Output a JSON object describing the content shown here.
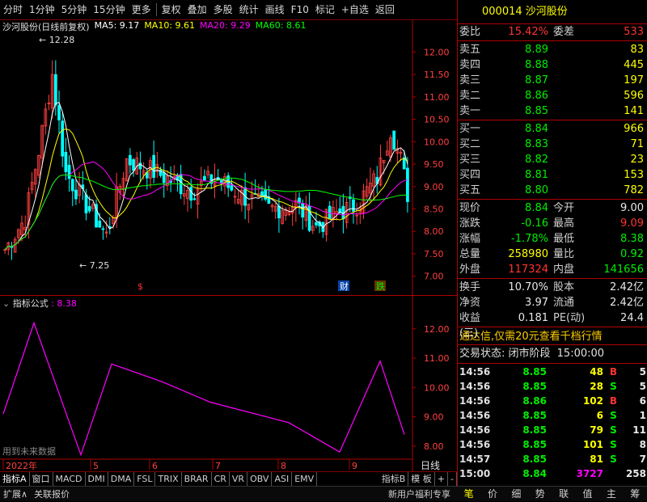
{
  "toolbar": {
    "items": [
      "分时",
      "1分钟",
      "5分钟",
      "15分钟",
      "更多",
      "复权",
      "叠加",
      "多股",
      "统计",
      "画线",
      "F10",
      "标记",
      "+自选",
      "返回"
    ]
  },
  "chart": {
    "stock_label": "沙河股份(日线前复权)",
    "ma5_label": "MA5: 9.17",
    "ma10_label": "MA10: 9.61",
    "ma20_label": "MA20: 9.29",
    "ma60_label": "MA60: 8.61",
    "colors": {
      "ma5": "#ffffff",
      "ma10": "#ffff00",
      "ma20": "#ff00ff",
      "ma60": "#00ff00",
      "up": "#ff4040",
      "down": "#00ffff"
    },
    "high_label": "12.28",
    "low_label": "7.25",
    "price_ticks": [
      "12.00",
      "11.50",
      "11.00",
      "10.50",
      "10.00",
      "9.50",
      "9.00",
      "8.50",
      "8.00",
      "7.50",
      "7.00"
    ],
    "event_marks": [
      "$",
      "财",
      "跌"
    ],
    "indicator_label": "指标公式",
    "indicator_value": ": 8.38",
    "indicator_ticks": [
      "12.00",
      "11.00",
      "10.00",
      "9.00",
      "8.00"
    ],
    "indicator_note": "用到未来数据",
    "x_labels": [
      "2022年",
      "5",
      "6",
      "7",
      "8",
      "9"
    ],
    "period_label": "日线"
  },
  "chart_data": {
    "type": "line",
    "x": [
      0,
      1,
      2,
      3,
      4,
      5,
      6,
      7,
      8,
      9
    ],
    "series": [
      {
        "values": [
          9.1,
          12.2,
          7.7,
          10.8,
          10.2,
          9.5,
          8.8,
          7.8,
          10.9,
          8.4
        ]
      }
    ],
    "ylim": [
      7.5,
      12.6
    ]
  },
  "bottom_tabs": [
    "指标A",
    "窗口",
    "MACD",
    "DMI",
    "DMA",
    "FSL",
    "TRIX",
    "BRAR",
    "CR",
    "VR",
    "OBV",
    "ASI",
    "EMV",
    "指标B",
    "模 板",
    "+",
    "-"
  ],
  "bottom_tabs2": [
    "扩展∧",
    "关联报价",
    "新用户福利专享"
  ],
  "right_tabs": [
    "笔",
    "价",
    "细",
    "势",
    "联",
    "值",
    "主",
    "筹"
  ],
  "quote": {
    "title": "000014 沙河股份",
    "weibi_label": "委比",
    "weibi": "15.42%",
    "weicha_label": "委差",
    "weicha": "533",
    "sell": [
      {
        "label": "卖五",
        "price": "8.89",
        "vol": "83"
      },
      {
        "label": "卖四",
        "price": "8.88",
        "vol": "445"
      },
      {
        "label": "卖三",
        "price": "8.87",
        "vol": "197"
      },
      {
        "label": "卖二",
        "price": "8.86",
        "vol": "596"
      },
      {
        "label": "卖一",
        "price": "8.85",
        "vol": "141"
      }
    ],
    "buy": [
      {
        "label": "买一",
        "price": "8.84",
        "vol": "966"
      },
      {
        "label": "买二",
        "price": "8.83",
        "vol": "71"
      },
      {
        "label": "买三",
        "price": "8.82",
        "vol": "23"
      },
      {
        "label": "买四",
        "price": "8.81",
        "vol": "153"
      },
      {
        "label": "买五",
        "price": "8.80",
        "vol": "782"
      }
    ],
    "stats1": [
      {
        "l1": "现价",
        "v1": "8.84",
        "c1": "green",
        "l2": "今开",
        "v2": "9.00",
        "c2": "white"
      },
      {
        "l1": "涨跌",
        "v1": "-0.16",
        "c1": "green",
        "l2": "最高",
        "v2": "9.09",
        "c2": "red"
      },
      {
        "l1": "涨幅",
        "v1": "-1.78%",
        "c1": "green",
        "l2": "最低",
        "v2": "8.38",
        "c2": "green"
      },
      {
        "l1": "总量",
        "v1": "258980",
        "c1": "yellow",
        "l2": "量比",
        "v2": "0.92",
        "c2": "green"
      },
      {
        "l1": "外盘",
        "v1": "117324",
        "c1": "red",
        "l2": "内盘",
        "v2": "141656",
        "c2": "green"
      }
    ],
    "stats2": [
      {
        "l1": "换手",
        "v1": "10.70%",
        "c1": "white",
        "l2": "股本",
        "v2": "2.42亿",
        "c2": "white"
      },
      {
        "l1": "净资",
        "v1": "3.97",
        "c1": "white",
        "l2": "流通",
        "v2": "2.42亿",
        "c2": "white"
      },
      {
        "l1": "收益(三)",
        "v1": "0.181",
        "c1": "white",
        "l2": "PE(动)",
        "v2": "24.4",
        "c2": "white"
      }
    ],
    "ad": "通达信,仅需20元查看千档行情",
    "state_label": "交易状态: 闭市阶段",
    "state_time": "15:00:00",
    "ticks": [
      {
        "t": "14:56",
        "p": "8.85",
        "v": "48",
        "bs": "B",
        "n": "5"
      },
      {
        "t": "14:56",
        "p": "8.85",
        "v": "28",
        "bs": "S",
        "n": "5"
      },
      {
        "t": "14:56",
        "p": "8.86",
        "v": "102",
        "bs": "B",
        "n": "6"
      },
      {
        "t": "14:56",
        "p": "8.85",
        "v": "6",
        "bs": "S",
        "n": "1"
      },
      {
        "t": "14:56",
        "p": "8.85",
        "v": "79",
        "bs": "S",
        "n": "11"
      },
      {
        "t": "14:56",
        "p": "8.85",
        "v": "101",
        "bs": "S",
        "n": "8"
      },
      {
        "t": "14:57",
        "p": "8.85",
        "v": "81",
        "bs": "S",
        "n": "7"
      },
      {
        "t": "15:00",
        "p": "8.84",
        "v": "3727",
        "bs": "",
        "n": "258"
      }
    ]
  }
}
